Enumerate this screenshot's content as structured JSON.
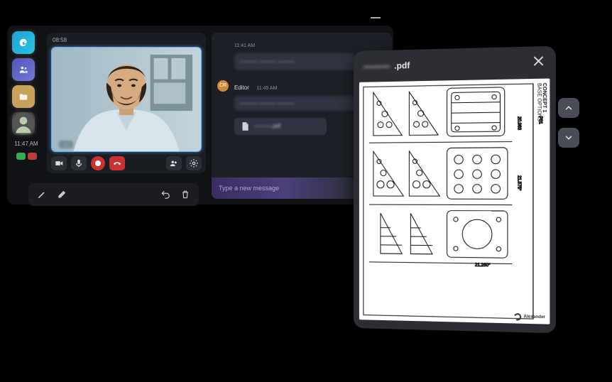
{
  "sidebar": {
    "apps": [
      {
        "name": "edge",
        "icon": "swirl"
      },
      {
        "name": "teams",
        "icon": "people"
      },
      {
        "name": "files",
        "icon": "folder"
      },
      {
        "name": "avatar",
        "icon": "avatar"
      }
    ],
    "time": "11:47 AM"
  },
  "call": {
    "elapsed": "08:58",
    "participant_name": "—",
    "controls": {
      "camera": "Camera",
      "mic": "Mic",
      "record": "Record",
      "hangup": "Hang up",
      "people": "People",
      "settings": "Settings"
    }
  },
  "chat": {
    "thread": [
      {
        "timestamp": "11:41 AM",
        "body": "———  ———  ———"
      },
      {
        "sender_initials": "CR",
        "sender": "Editor",
        "timestamp": "11:45 AM",
        "body": "———  ———  ———"
      }
    ],
    "attachment": {
      "icon": "file",
      "name": "———.pdf"
    },
    "composer_placeholder": "Type a new message"
  },
  "toolbar": {
    "pen": "Pen",
    "eraser": "Eraser",
    "undo": "Undo",
    "delete": "Delete"
  },
  "pdf": {
    "title_prefix": "———",
    "title_ext": ".pdf",
    "drawing": {
      "concept_label": "CONCEPT 1",
      "sublabel": "BASE OPTIONS",
      "page_number": "P01",
      "brand": "Alexander"
    },
    "nav": {
      "up": "Previous page",
      "down": "Next page"
    }
  }
}
